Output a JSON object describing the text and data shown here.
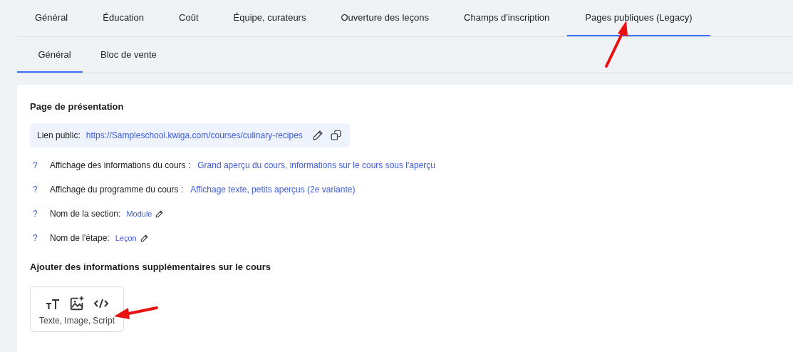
{
  "tabs": [
    {
      "label": "Général",
      "selected": false
    },
    {
      "label": "Éducation",
      "selected": false
    },
    {
      "label": "Coût",
      "selected": false
    },
    {
      "label": "Équipe, curateurs",
      "selected": false
    },
    {
      "label": "Ouverture des leçons",
      "selected": false
    },
    {
      "label": "Champs d'inscription",
      "selected": false
    },
    {
      "label": "Pages publiques (Legacy)",
      "selected": true
    }
  ],
  "subtabs": [
    {
      "label": "Général",
      "selected": true
    },
    {
      "label": "Bloc de vente",
      "selected": false
    }
  ],
  "section": {
    "title": "Page de présentation",
    "public_link": {
      "label": "Lien public:",
      "url": "https://Sampleschool.kwiga.com/courses/culinary-recipes"
    },
    "settings": [
      {
        "help": "?",
        "label": "Affichage des informations du cours :",
        "value": "Grand aperçu du cours, informations sur le cours sous l'aperçu",
        "editable": false
      },
      {
        "help": "?",
        "label": "Affichage du programme du cours :",
        "value": "Affichage texte, petits aperçus (2e variante)",
        "editable": false
      },
      {
        "help": "?",
        "label": "Nom de la section:",
        "value": "Module",
        "editable": true
      },
      {
        "help": "?",
        "label": "Nom de l'étape:",
        "value": "Leçon",
        "editable": true
      }
    ]
  },
  "extra": {
    "title": "Ajouter des informations supplémentaires sur le cours",
    "block_label": "Texte, Image, Script"
  }
}
